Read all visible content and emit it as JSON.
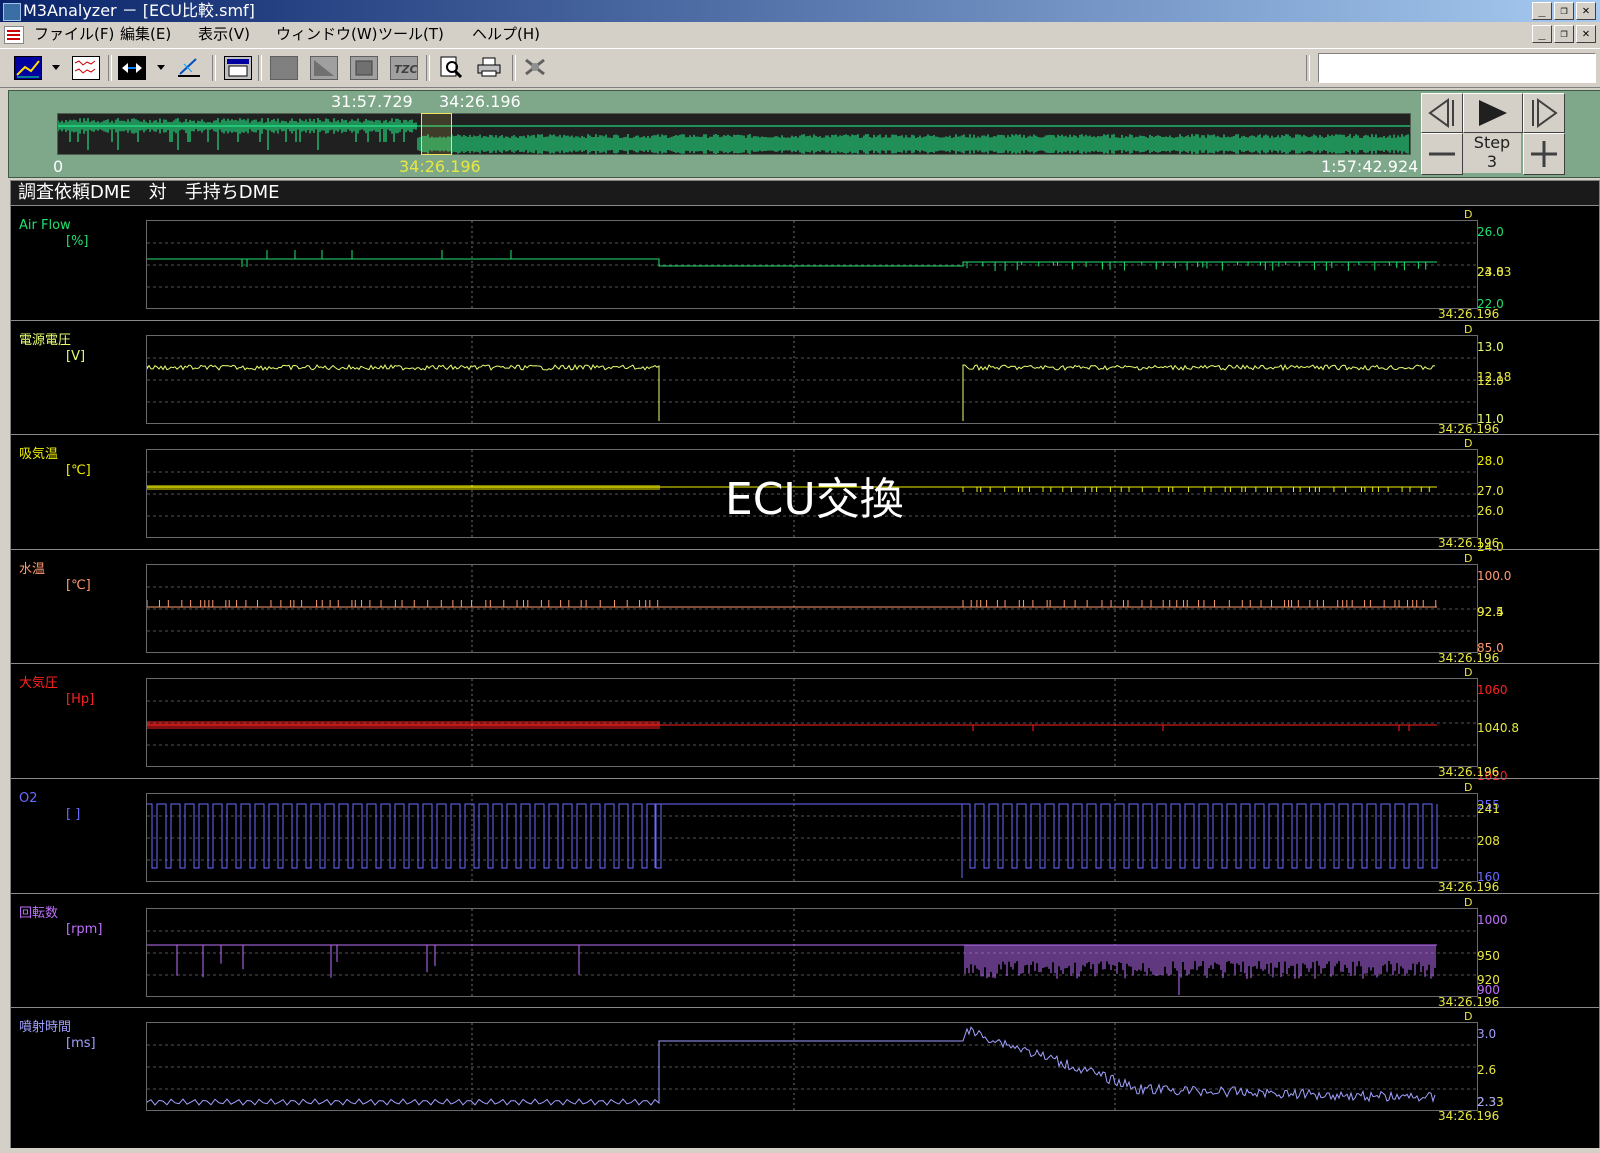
{
  "window": {
    "title": "M3Analyzer － [ECU比較.smf]"
  },
  "menu": [
    "ファイル(F)",
    "編集(E)",
    "表示(V)",
    "ウィンドウ(W)",
    "ツール(T)",
    "ヘルプ(H)"
  ],
  "toolbar_icons": [
    "graph-icon",
    "waveform-icon",
    "zoom-fit-icon",
    "measure-icon",
    "data-window-icon",
    "box-gray-icon",
    "box-corner-icon",
    "box-frame-icon",
    "tzc-icon",
    "preview-icon",
    "print-icon",
    "plugin-icon"
  ],
  "navigator": {
    "sel_start": "31:57.729",
    "sel_end": "34:26.196",
    "range_start": "0",
    "cursor": "34:26.196",
    "range_end": "1:57:42.924",
    "sel_start_frac": 0.271,
    "sel_end_frac": 0.292,
    "step_label": "Step",
    "step_value": "3"
  },
  "panel_title": "調査依頼DME　対　手持ちDME",
  "annotation": "ECU交換",
  "channels": [
    {
      "name": "Air Flow",
      "unit": "[%]",
      "color": "#20e070",
      "ticks": [
        "26.0",
        "24.0",
        "23.83",
        "22.0"
      ],
      "cursor": "34:26.196"
    },
    {
      "name": "電源電圧",
      "unit": "[V]",
      "color": "#e6ff70",
      "ticks": [
        "13.0",
        "12.18",
        "12.0",
        "11.0"
      ],
      "cursor": "34:26.196"
    },
    {
      "name": "吸気温",
      "unit": "[℃]",
      "color": "#f0f000",
      "ticks": [
        "28.0",
        "27.0",
        "26.0",
        "24.0"
      ],
      "cursor": "34:26.196"
    },
    {
      "name": "水温",
      "unit": "[℃]",
      "color": "#ff9a70",
      "ticks": [
        "100.0",
        "92.5",
        "92.4",
        "85.0"
      ],
      "cursor": "34:26.196"
    },
    {
      "name": "大気圧",
      "unit": "[Hp]",
      "color": "#ff2020",
      "ticks": [
        "1060",
        "1040.8",
        "1020"
      ],
      "cursor": "34:26.196"
    },
    {
      "name": "O2",
      "unit": "[ ]",
      "color": "#6a6aff",
      "ticks": [
        "255",
        "241",
        "208",
        "160"
      ],
      "cursor": "34:26.196"
    },
    {
      "name": "回転数",
      "unit": "[rpm]",
      "color": "#c070ff",
      "ticks": [
        "1000",
        "950",
        "920",
        "900"
      ],
      "cursor": "34:26.196"
    },
    {
      "name": "噴射時間",
      "unit": "[ms]",
      "color": "#a0a0ff",
      "ticks": [
        "3.0",
        "2.6",
        "2.33",
        "2.3"
      ],
      "cursor": "34:26.196"
    }
  ]
}
